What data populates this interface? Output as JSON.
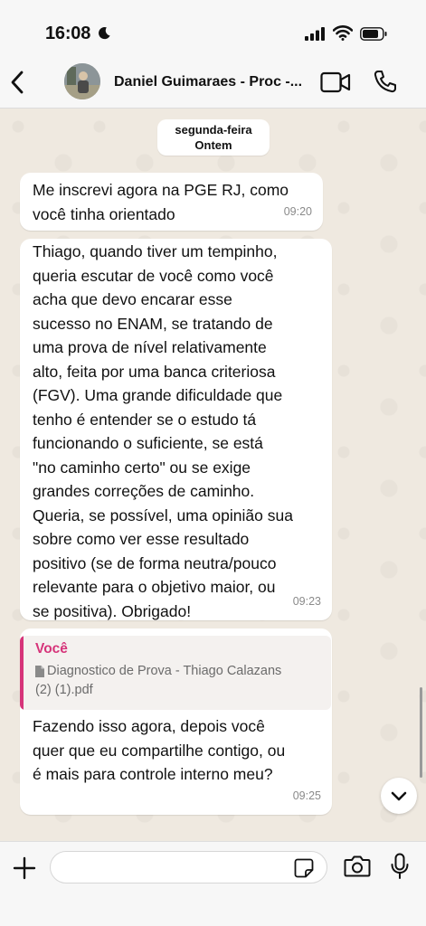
{
  "status_bar": {
    "time": "16:08"
  },
  "header": {
    "contact_name": "Daniel Guimaraes - Proc -..."
  },
  "date_chip": {
    "day": "segunda-feira",
    "relative": "Ontem"
  },
  "messages": [
    {
      "text": "Me inscrevi agora na PGE RJ, como\nvocê tinha orientado",
      "time": "09:20"
    },
    {
      "text": "Thiago, quando tiver um tempinho,\nqueria escutar de você como você\nacha que devo encarar esse\nsucesso no ENAM, se tratando de\numa prova de nível relativamente\nalto, feita por uma banca criteriosa\n(FGV). Uma grande dificuldade que\ntenho é entender se o estudo tá\nfuncionando o suficiente, se está\n\"no caminho certo\" ou se exige\ngrandes correções de caminho.\nQueria, se possível, uma opinião sua\nsobre como ver esse resultado\npositivo (se de forma neutra/pouco\nrelevante para o objetivo maior, ou\nse positiva). Obrigado!",
      "time": "09:23"
    },
    {
      "quote_author": "Você",
      "quote_line1": "Diagnostico de Prova - Thiago Calazans",
      "quote_line2": "(2) (1).pdf",
      "text": "Fazendo isso agora, depois você\nquer que eu compartilhe contigo, ou\né mais para controle interno meu?",
      "time": "09:25"
    }
  ],
  "input": {
    "value": "",
    "placeholder": ""
  },
  "colors": {
    "quote_accent": "#d6347a",
    "wallpaper": "#efe9e0",
    "bubble": "#ffffff"
  },
  "icons": [
    "moon-icon",
    "signal-icon",
    "wifi-icon",
    "battery-icon",
    "back-chevron-icon",
    "video-call-icon",
    "phone-call-icon",
    "document-icon",
    "chevron-down-icon",
    "plus-icon",
    "sticker-icon",
    "camera-icon",
    "microphone-icon"
  ]
}
